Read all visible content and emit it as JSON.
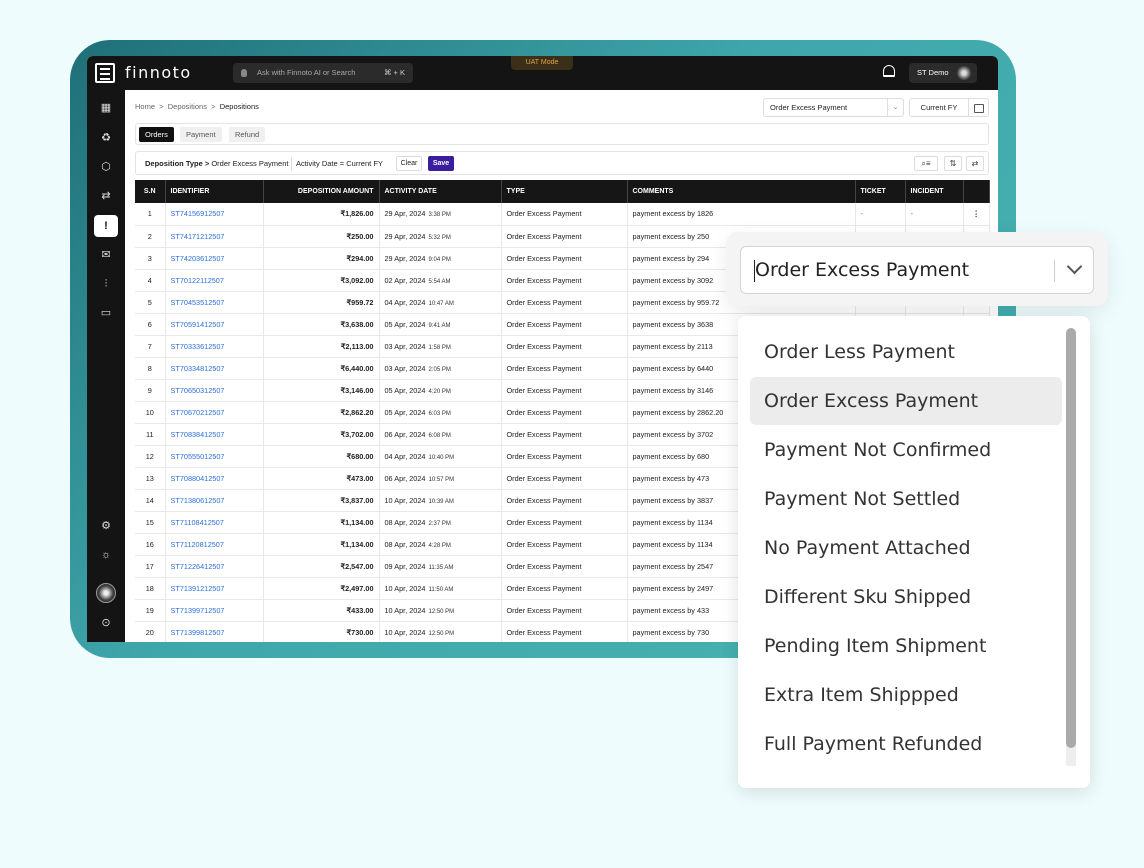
{
  "app": {
    "brand": "finnoto",
    "search_placeholder": "Ask with Finnoto AI or Search",
    "search_shortcut": "⌘ + K",
    "mode_badge": "UAT Mode",
    "user_name": "ST Demo"
  },
  "breadcrumb": {
    "home": "Home",
    "sep": ">",
    "level1": "Depositions",
    "level2": "Depositions"
  },
  "header": {
    "type_select": "Order Excess Payment",
    "fy_select": "Current FY"
  },
  "tabs": [
    "Orders",
    "Payment",
    "Refund"
  ],
  "filters": {
    "type_label": "Deposition Type >",
    "type_value": "Order Excess Payment",
    "date_filter": "Activity Date = Current FY",
    "clear": "Clear",
    "save": "Save"
  },
  "table": {
    "columns": [
      "S.N",
      "IDENTIFIER",
      "DEPOSITION AMOUNT",
      "ACTIVITY DATE",
      "TYPE",
      "COMMENTS",
      "TICKET",
      "INCIDENT"
    ],
    "rows": [
      {
        "sn": "1",
        "id": "ST74156912507",
        "amt": "₹1,826.00",
        "date": "29 Apr, 2024",
        "time": "3:38 PM",
        "type": "Order Excess Payment",
        "comment": "payment excess by 1826",
        "ticket": "-",
        "incident": "-"
      },
      {
        "sn": "2",
        "id": "ST74171212507",
        "amt": "₹250.00",
        "date": "29 Apr, 2024",
        "time": "5:32 PM",
        "type": "Order Excess Payment",
        "comment": "payment excess by 250",
        "ticket": "",
        "incident": ""
      },
      {
        "sn": "3",
        "id": "ST74203612507",
        "amt": "₹294.00",
        "date": "29 Apr, 2024",
        "time": "9:04 PM",
        "type": "Order Excess Payment",
        "comment": "payment excess by 294",
        "ticket": "",
        "incident": ""
      },
      {
        "sn": "4",
        "id": "ST70122112507",
        "amt": "₹3,092.00",
        "date": "02 Apr, 2024",
        "time": "5:54 AM",
        "type": "Order Excess Payment",
        "comment": "payment excess by 3092",
        "ticket": "",
        "incident": ""
      },
      {
        "sn": "5",
        "id": "ST70453512507",
        "amt": "₹959.72",
        "date": "04 Apr, 2024",
        "time": "10:47 AM",
        "type": "Order Excess Payment",
        "comment": "payment excess by 959.72",
        "ticket": "",
        "incident": ""
      },
      {
        "sn": "6",
        "id": "ST70591412507",
        "amt": "₹3,638.00",
        "date": "05 Apr, 2024",
        "time": "9:41 AM",
        "type": "Order Excess Payment",
        "comment": "payment excess by 3638",
        "ticket": "",
        "incident": ""
      },
      {
        "sn": "7",
        "id": "ST70333612507",
        "amt": "₹2,113.00",
        "date": "03 Apr, 2024",
        "time": "1:58 PM",
        "type": "Order Excess Payment",
        "comment": "payment excess by 2113",
        "ticket": "",
        "incident": ""
      },
      {
        "sn": "8",
        "id": "ST70334812507",
        "amt": "₹6,440.00",
        "date": "03 Apr, 2024",
        "time": "2:05 PM",
        "type": "Order Excess Payment",
        "comment": "payment excess by 6440",
        "ticket": "",
        "incident": ""
      },
      {
        "sn": "9",
        "id": "ST70650312507",
        "amt": "₹3,146.00",
        "date": "05 Apr, 2024",
        "time": "4:20 PM",
        "type": "Order Excess Payment",
        "comment": "payment excess by 3146",
        "ticket": "",
        "incident": ""
      },
      {
        "sn": "10",
        "id": "ST70670212507",
        "amt": "₹2,862.20",
        "date": "05 Apr, 2024",
        "time": "6:03 PM",
        "type": "Order Excess Payment",
        "comment": "payment excess by 2862.20",
        "ticket": "",
        "incident": ""
      },
      {
        "sn": "11",
        "id": "ST70838412507",
        "amt": "₹3,702.00",
        "date": "06 Apr, 2024",
        "time": "6:08 PM",
        "type": "Order Excess Payment",
        "comment": "payment excess by 3702",
        "ticket": "",
        "incident": ""
      },
      {
        "sn": "12",
        "id": "ST70555012507",
        "amt": "₹680.00",
        "date": "04 Apr, 2024",
        "time": "10:40 PM",
        "type": "Order Excess Payment",
        "comment": "payment excess by 680",
        "ticket": "",
        "incident": ""
      },
      {
        "sn": "13",
        "id": "ST70880412507",
        "amt": "₹473.00",
        "date": "06 Apr, 2024",
        "time": "10:57 PM",
        "type": "Order Excess Payment",
        "comment": "payment excess by 473",
        "ticket": "",
        "incident": ""
      },
      {
        "sn": "14",
        "id": "ST71380612507",
        "amt": "₹3,837.00",
        "date": "10 Apr, 2024",
        "time": "10:39 AM",
        "type": "Order Excess Payment",
        "comment": "payment excess by 3837",
        "ticket": "",
        "incident": ""
      },
      {
        "sn": "15",
        "id": "ST71108412507",
        "amt": "₹1,134.00",
        "date": "08 Apr, 2024",
        "time": "2:37 PM",
        "type": "Order Excess Payment",
        "comment": "payment excess by 1134",
        "ticket": "",
        "incident": ""
      },
      {
        "sn": "16",
        "id": "ST71120812507",
        "amt": "₹1,134.00",
        "date": "08 Apr, 2024",
        "time": "4:28 PM",
        "type": "Order Excess Payment",
        "comment": "payment excess by 1134",
        "ticket": "",
        "incident": ""
      },
      {
        "sn": "17",
        "id": "ST71226412507",
        "amt": "₹2,547.00",
        "date": "09 Apr, 2024",
        "time": "11:35 AM",
        "type": "Order Excess Payment",
        "comment": "payment excess by 2547",
        "ticket": "",
        "incident": ""
      },
      {
        "sn": "18",
        "id": "ST71391212507",
        "amt": "₹2,497.00",
        "date": "10 Apr, 2024",
        "time": "11:50 AM",
        "type": "Order Excess Payment",
        "comment": "payment excess by 2497",
        "ticket": "",
        "incident": ""
      },
      {
        "sn": "19",
        "id": "ST71399712507",
        "amt": "₹433.00",
        "date": "10 Apr, 2024",
        "time": "12:50 PM",
        "type": "Order Excess Payment",
        "comment": "payment excess by 433",
        "ticket": "",
        "incident": ""
      },
      {
        "sn": "20",
        "id": "ST71399812507",
        "amt": "₹730.00",
        "date": "10 Apr, 2024",
        "time": "12:50 PM",
        "type": "Order Excess Payment",
        "comment": "payment excess by 730",
        "ticket": "",
        "incident": ""
      }
    ]
  },
  "dropdown": {
    "value": "Order Excess Payment",
    "selected_index": 1,
    "options": [
      "Order Less Payment",
      "Order Excess Payment",
      "Payment Not Confirmed",
      "Payment Not Settled",
      "No Payment Attached",
      "Different Sku Shipped",
      "Pending Item Shipment",
      "Extra Item Shippped",
      "Full Payment Refunded"
    ]
  },
  "colors": {
    "accent": "#3b1ea0",
    "link": "#2b6fd6",
    "dark": "#141414",
    "frame": "#3fa7ac"
  },
  "sidebar_icons": [
    "dashboard-icon",
    "recycle-icon",
    "box-icon",
    "transfer-icon",
    "deposition-icon",
    "mail-icon",
    "sliders-icon",
    "book-icon",
    "settings-icon",
    "sun-icon",
    "avatar",
    "expand-icon"
  ]
}
